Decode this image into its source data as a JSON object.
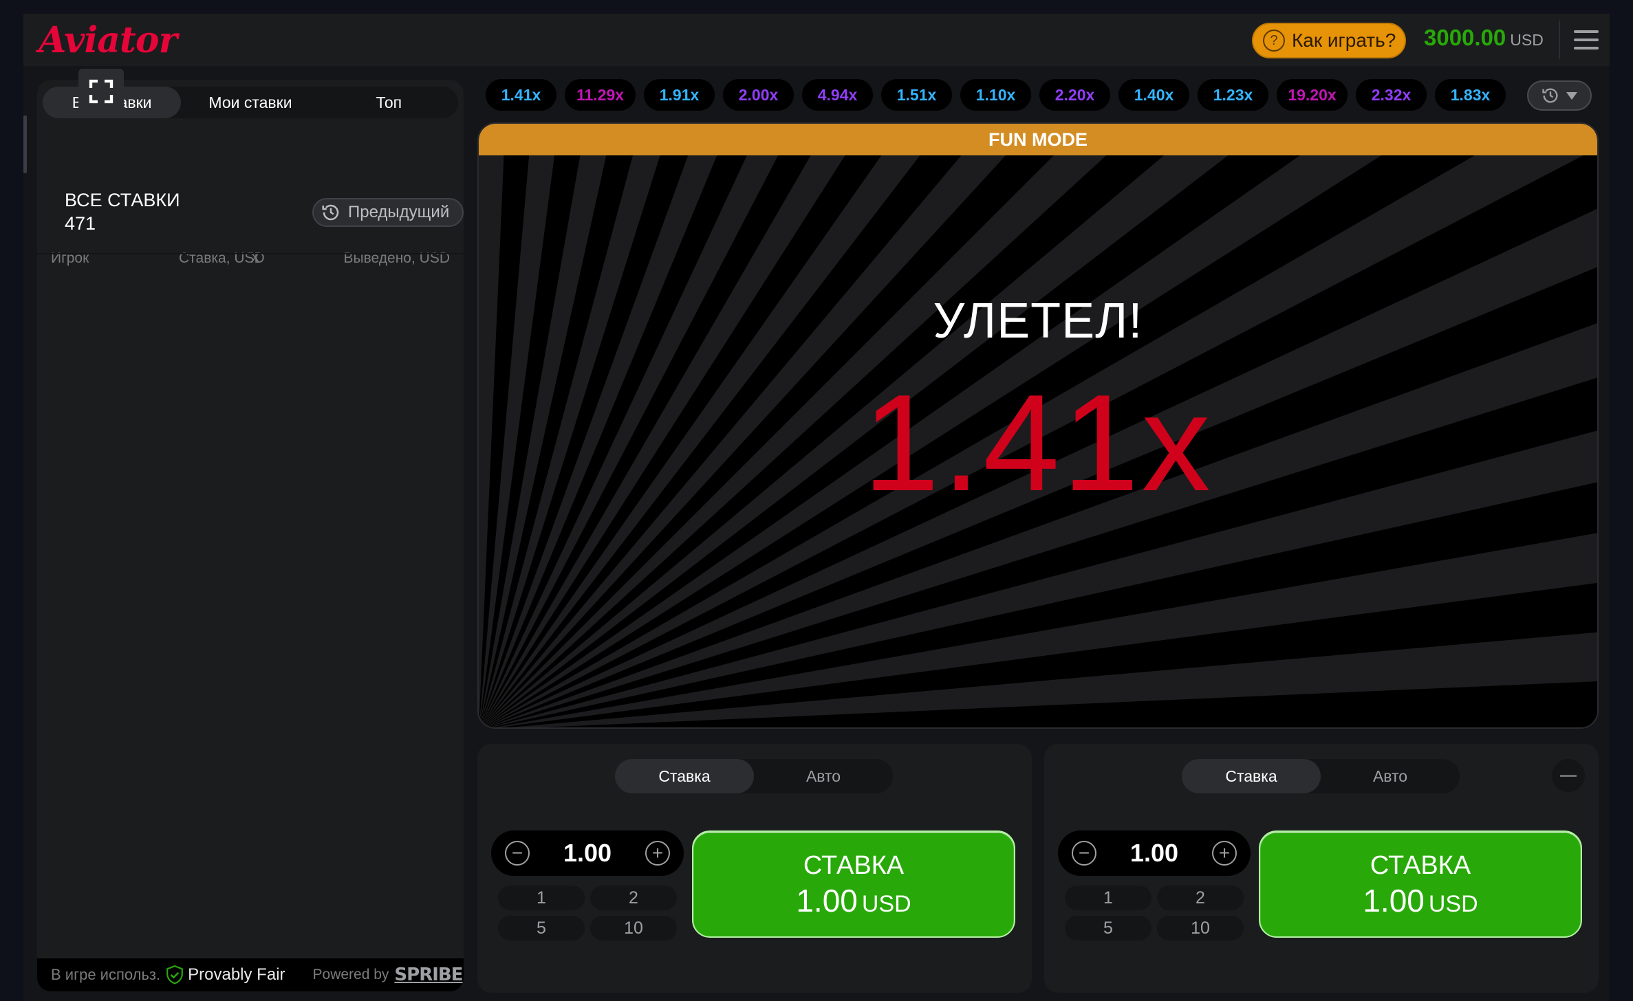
{
  "header": {
    "logo": "Aviator",
    "how_to_play": "Как играть?",
    "balance": "3000.00",
    "currency": "USD"
  },
  "bets_panel": {
    "tabs": [
      "Все ставки",
      "Мои ставки",
      "Топ"
    ],
    "active_tab": 0,
    "title": "ВСЕ СТАВКИ",
    "count": "471",
    "previous_button": "Предыдущий",
    "columns": [
      "Игрок",
      "Ставка, USD",
      "X",
      "Выведено, USD"
    ],
    "footer": {
      "using": "В игре использ.",
      "provably_fair": "Provably Fair",
      "powered_by": "Powered by",
      "brand": "SPRIBE"
    }
  },
  "history": [
    {
      "value": "1.41x",
      "color": "#34b4ff"
    },
    {
      "value": "11.29x",
      "color": "#c017b4"
    },
    {
      "value": "1.91x",
      "color": "#34b4ff"
    },
    {
      "value": "2.00x",
      "color": "#913ef8"
    },
    {
      "value": "4.94x",
      "color": "#913ef8"
    },
    {
      "value": "1.51x",
      "color": "#34b4ff"
    },
    {
      "value": "1.10x",
      "color": "#34b4ff"
    },
    {
      "value": "2.20x",
      "color": "#913ef8"
    },
    {
      "value": "1.40x",
      "color": "#34b4ff"
    },
    {
      "value": "1.23x",
      "color": "#34b4ff"
    },
    {
      "value": "19.20x",
      "color": "#c017b4"
    },
    {
      "value": "2.32x",
      "color": "#913ef8"
    },
    {
      "value": "1.83x",
      "color": "#34b4ff"
    }
  ],
  "game": {
    "mode_banner": "FUN MODE",
    "status": "УЛЕТЕЛ!",
    "multiplier": "1.41x",
    "multiplier_color": "#d0021b"
  },
  "bet_panels": [
    {
      "tabs": [
        "Ставка",
        "Авто"
      ],
      "active_tab": 0,
      "amount": "1.00",
      "quick_amounts": [
        "1",
        "2",
        "5",
        "10"
      ],
      "button_label": "СТАВКА",
      "button_amount": "1.00",
      "button_currency": "USD"
    },
    {
      "tabs": [
        "Ставка",
        "Авто"
      ],
      "active_tab": 0,
      "amount": "1.00",
      "quick_amounts": [
        "1",
        "2",
        "5",
        "10"
      ],
      "button_label": "СТАВКА",
      "button_amount": "1.00",
      "button_currency": "USD"
    }
  ],
  "colors": {
    "accent_red": "#e50539",
    "balance_green": "#28a909",
    "bet_button_green": "#28a909",
    "fun_mode_orange": "#d38d23",
    "how_to_play_orange": "#e69308"
  }
}
